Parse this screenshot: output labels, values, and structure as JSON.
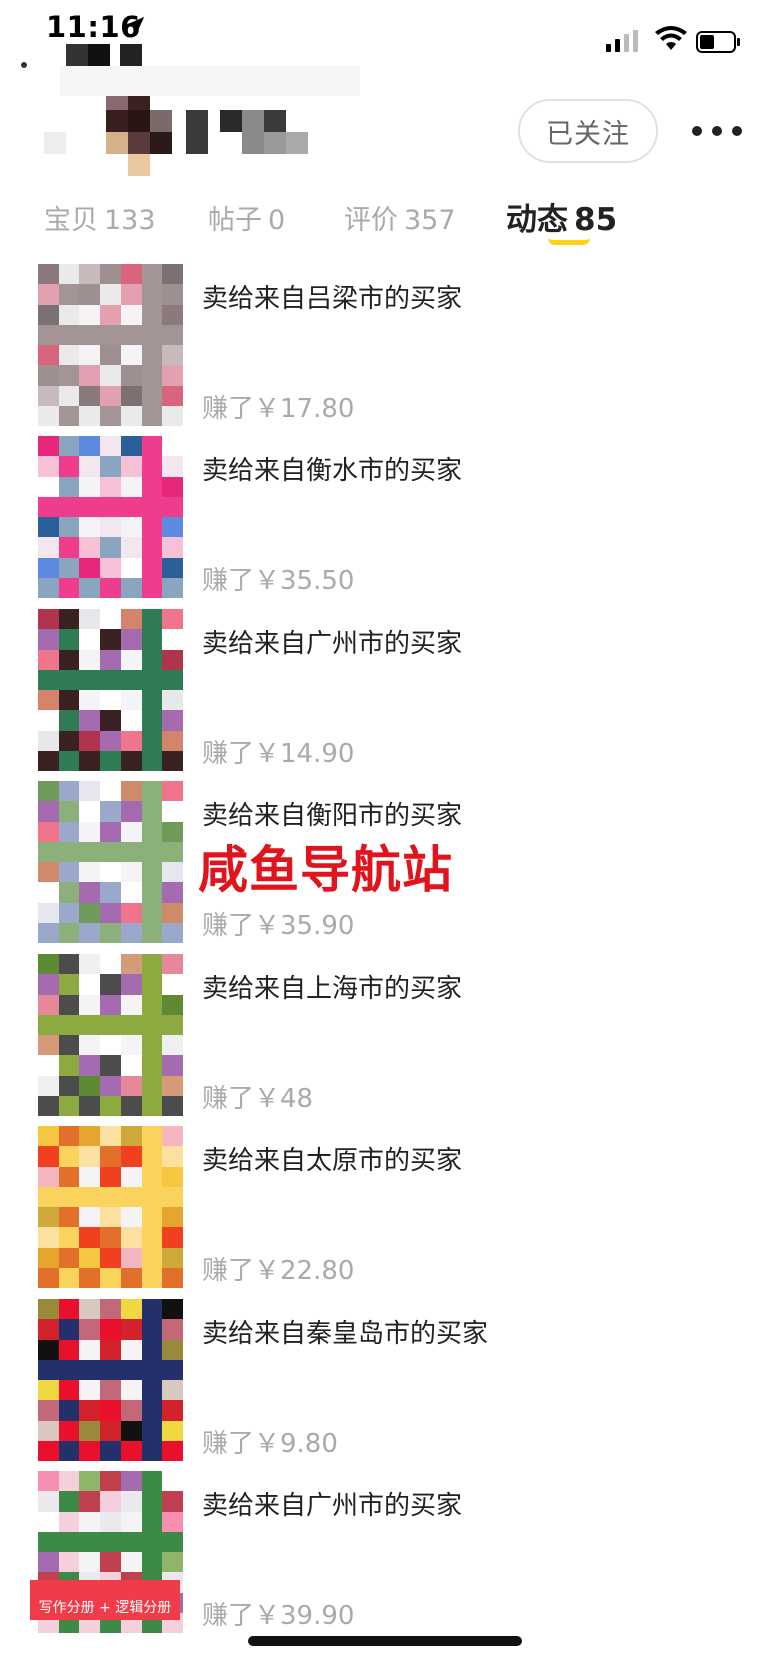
{
  "status_bar": {
    "time": "11:16"
  },
  "header": {
    "follow_label": "已关注"
  },
  "tabs": [
    {
      "label": "宝贝",
      "count": "133"
    },
    {
      "label": "帖子",
      "count": "0"
    },
    {
      "label": "评价",
      "count": "357"
    },
    {
      "label": "动态",
      "count": "85"
    }
  ],
  "items": [
    {
      "title": "卖给来自吕梁市的买家",
      "earned": "赚了￥17.80"
    },
    {
      "title": "卖给来自衡水市的买家",
      "earned": "赚了￥35.50"
    },
    {
      "title": "卖给来自广州市的买家",
      "earned": "赚了￥14.90"
    },
    {
      "title": "卖给来自衡阳市的买家",
      "earned": "赚了￥35.90"
    },
    {
      "title": "卖给来自上海市的买家",
      "earned": "赚了￥48"
    },
    {
      "title": "卖给来自太原市的买家",
      "earned": "赚了￥22.80"
    },
    {
      "title": "卖给来自秦皇岛市的买家",
      "earned": "赚了￥9.80"
    },
    {
      "title": "卖给来自广州市的买家",
      "earned": "赚了￥39.90"
    }
  ],
  "watermark": "咸鱼导航站",
  "banner_text": "写作分册 + 逻辑分册",
  "colors": {
    "accent": "#ffd21a",
    "watermark": "#e1141e"
  },
  "icons": {
    "location": "location-arrow-icon",
    "signal": "cellular-signal-icon",
    "wifi": "wifi-icon",
    "battery": "battery-icon",
    "more": "more-dots-icon"
  }
}
